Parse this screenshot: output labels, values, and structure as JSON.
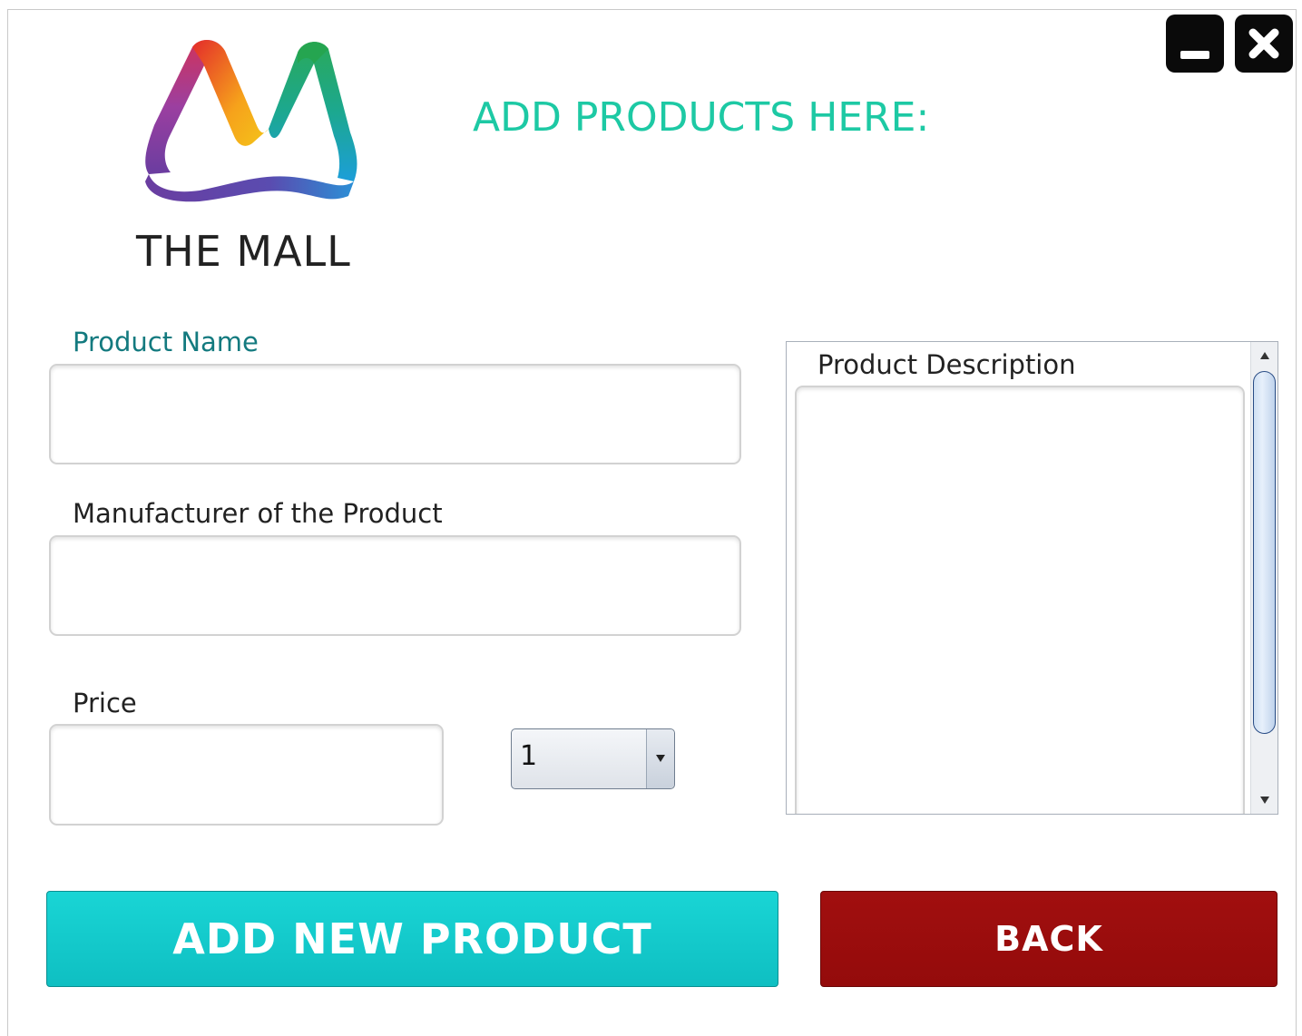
{
  "window": {
    "minimize_icon": "minimize-icon",
    "close_icon": "close-icon"
  },
  "brand": {
    "name": "THE MALL",
    "logo_icon": "the-mall-logo-icon"
  },
  "heading": "ADD PRODUCTS HERE:",
  "form": {
    "product_name": {
      "label": "Product Name",
      "value": ""
    },
    "manufacturer": {
      "label": "Manufacturer of the Product",
      "value": ""
    },
    "price": {
      "label": "Price",
      "value": ""
    },
    "quantity": {
      "selected": "1"
    },
    "description": {
      "label": "Product Description",
      "value": ""
    }
  },
  "buttons": {
    "add": "ADD NEW PRODUCT",
    "back": "BACK"
  },
  "colors": {
    "heading": "#1dc9a4",
    "add_button": "#12c9cb",
    "back_button": "#9b0d0d"
  }
}
